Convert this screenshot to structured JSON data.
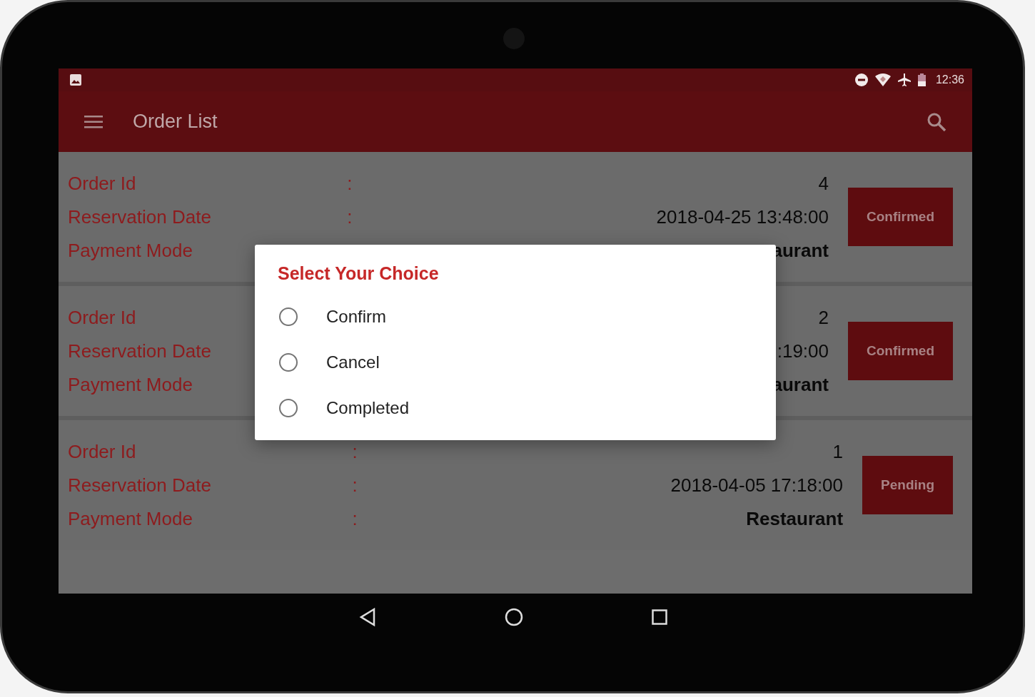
{
  "status_bar": {
    "time": "12:36"
  },
  "app_bar": {
    "title": "Order List"
  },
  "orders": [
    {
      "rows": [
        {
          "label": "Order Id",
          "colon": ":",
          "value": "4"
        },
        {
          "label": "Reservation Date",
          "colon": ":",
          "value": "2018-04-25 13:48:00"
        },
        {
          "label": "Payment Mode",
          "value": "aurant"
        }
      ],
      "status": "Confirmed"
    },
    {
      "rows": [
        {
          "label": "Order Id",
          "value": "2"
        },
        {
          "label": "Reservation Date",
          "value": ":19:00"
        },
        {
          "label": "Payment Mode",
          "value": "aurant"
        }
      ],
      "status": "Confirmed"
    },
    {
      "rows": [
        {
          "label": "Order Id",
          "colon": ":",
          "value": "1"
        },
        {
          "label": "Reservation Date",
          "colon": ":",
          "value": "2018-04-05 17:18:00"
        },
        {
          "label": "Payment Mode",
          "colon": ":",
          "value": "Restaurant"
        }
      ],
      "status": "Pending"
    }
  ],
  "dialog": {
    "title": "Select Your Choice",
    "options": [
      {
        "label": "Confirm",
        "selected": false
      },
      {
        "label": "Cancel",
        "selected": false
      },
      {
        "label": "Completed",
        "selected": false
      }
    ]
  }
}
